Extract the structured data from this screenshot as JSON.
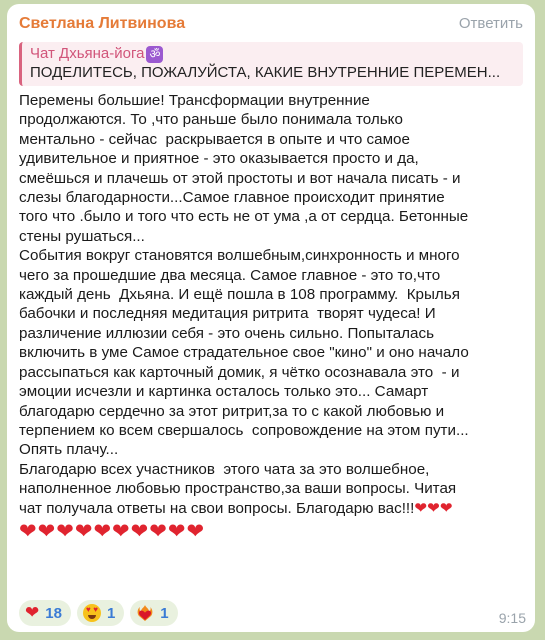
{
  "message": {
    "sender": "Светлана Литвинова",
    "reply_label": "Ответить",
    "quote": {
      "chat_name": "Чат Дхьяна-йога",
      "chat_icon": "om-icon",
      "text": "ПОДЕЛИТЕСЬ, ПОЖАЛУЙСТА, КАКИЕ ВНУТРЕННИЕ ПЕРЕМЕН..."
    },
    "lines": [
      "Перемены большие! Трансформации внутренние",
      "продолжаются. То ,что раньше было понимала только",
      "ментально - сейчас  раскрывается в опыте и что самое",
      "удивительное и приятное - это оказывается просто и да,",
      "смеёшься и плачешь от этой простоты и вот начала писать - и",
      "слезы благодарности...Самое главное происходит принятие",
      "того что .было и того что есть не от ума ,а от сердца. Бетонные",
      "стены рушаться...",
      "События вокруг становятся волшебным,синхронность и много",
      "чего за прошедшие два месяца. Самое главное - это то,что",
      "каждый день  Дхьяна. И ещё пошла в 108 программу.  Крылья",
      "бабочки и последняя медитация ритрита  творят чудеса! И",
      "различение иллюзии себя - это очень сильно. Попыталась",
      "включить в уме Самое страдательное свое \"кино\" и оно начало",
      "рассыпаться как карточный домик, я чётко осознавала это  - и",
      "эмоции исчезли и картинка осталось только это... Самарт",
      "благодарю сердечно за этот ритрит,за то с какой любовью и",
      "терпением ко всем свершалось  сопровождение на этом пути...",
      "Опять плачу...",
      "Благодарю всех участников  этого чата за это волшебное,",
      "наполненное любовью пространство,за ваши вопросы. Читая",
      "чат получала ответы на свои вопросы. Благодарю вас!!!"
    ],
    "last_line_hearts": "❤❤❤",
    "hearts_row": [
      "❤",
      "❤",
      "❤",
      "❤",
      "❤",
      "❤",
      "❤",
      "❤",
      "❤",
      "❤"
    ],
    "reactions": [
      {
        "icon": "red-heart-icon",
        "count": "18"
      },
      {
        "icon": "heart-eyes-face-icon",
        "count": "1"
      },
      {
        "icon": "heart-on-fire-icon",
        "count": "1"
      }
    ],
    "time": "9:15"
  },
  "colors": {
    "background": "#c9d8b0",
    "sender": "#e57b38",
    "quote_accent": "#d9637f",
    "reaction_count": "#3a7bd5",
    "heart": "#e0242f"
  }
}
